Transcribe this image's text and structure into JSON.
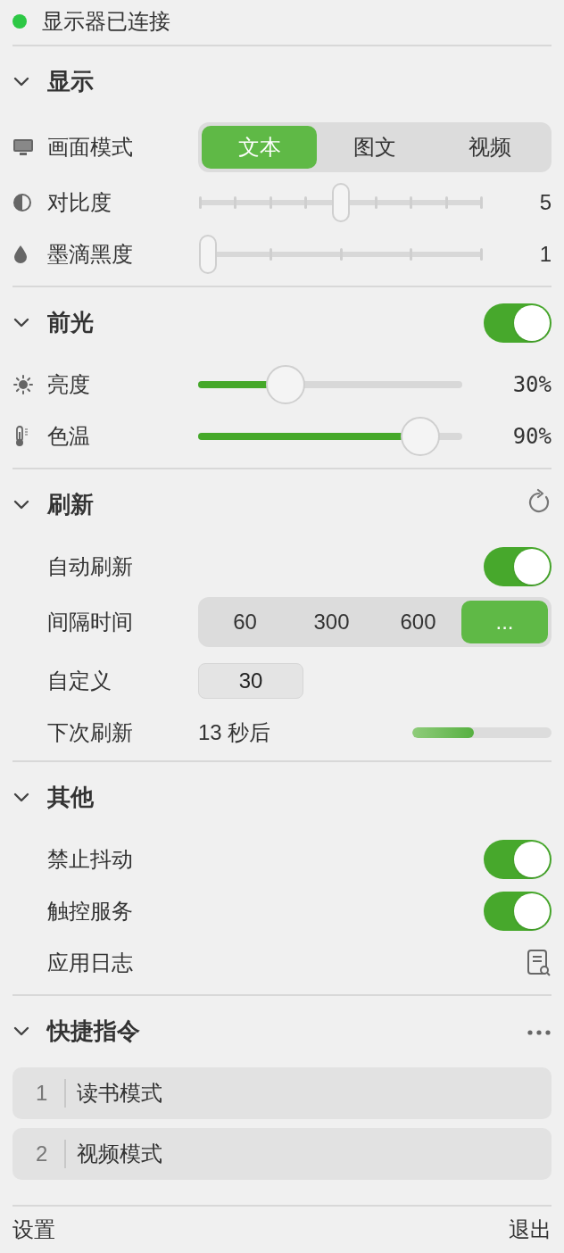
{
  "status": {
    "text": "显示器已连接",
    "connected": true
  },
  "sections": [
    {
      "title": "显示",
      "expanded": true,
      "rows": [
        {
          "kind": "segmented",
          "label": "画面模式",
          "options": [
            {
              "label": "文本",
              "selected": true
            },
            {
              "label": "图文",
              "selected": false
            },
            {
              "label": "视频",
              "selected": false
            }
          ]
        },
        {
          "kind": "stepped",
          "label": "对比度",
          "level": 0.5,
          "reading": "5"
        },
        {
          "kind": "stepped",
          "label": "墨滴黑度",
          "level": 0,
          "reading": "1"
        }
      ]
    },
    {
      "title": "前光",
      "expanded": true,
      "on": true,
      "rows": [
        {
          "kind": "slider",
          "label": "亮度",
          "level": 0.3,
          "reading": "30%"
        },
        {
          "kind": "slider",
          "label": "色温",
          "level": 0.9,
          "reading": "90%"
        }
      ]
    },
    {
      "title": "刷新",
      "expanded": true,
      "rows": [
        {
          "kind": "toggle",
          "label": "自动刷新",
          "on": true
        },
        {
          "kind": "segmented",
          "label": "间隔时间",
          "options": [
            {
              "label": "60",
              "selected": false
            },
            {
              "label": "300",
              "selected": false
            },
            {
              "label": "600",
              "selected": false
            },
            {
              "label": "...",
              "selected": true
            }
          ]
        },
        {
          "kind": "field",
          "label": "自定义",
          "value": "30"
        },
        {
          "kind": "progress",
          "label": "下次刷新",
          "reading": "13 秒后",
          "level": 0.44
        }
      ]
    },
    {
      "title": "其他",
      "expanded": true,
      "rows": [
        {
          "kind": "toggle",
          "label": "禁止抖动",
          "on": true
        },
        {
          "kind": "toggle",
          "label": "触控服务",
          "on": true
        },
        {
          "kind": "action",
          "label": "应用日志"
        }
      ]
    },
    {
      "title": "快捷指令",
      "expanded": true,
      "shortcuts": [
        {
          "number": "1",
          "label": "读书模式"
        },
        {
          "number": "2",
          "label": "视频模式"
        }
      ]
    }
  ],
  "footer": {
    "settings": "设置",
    "quit": "退出"
  }
}
